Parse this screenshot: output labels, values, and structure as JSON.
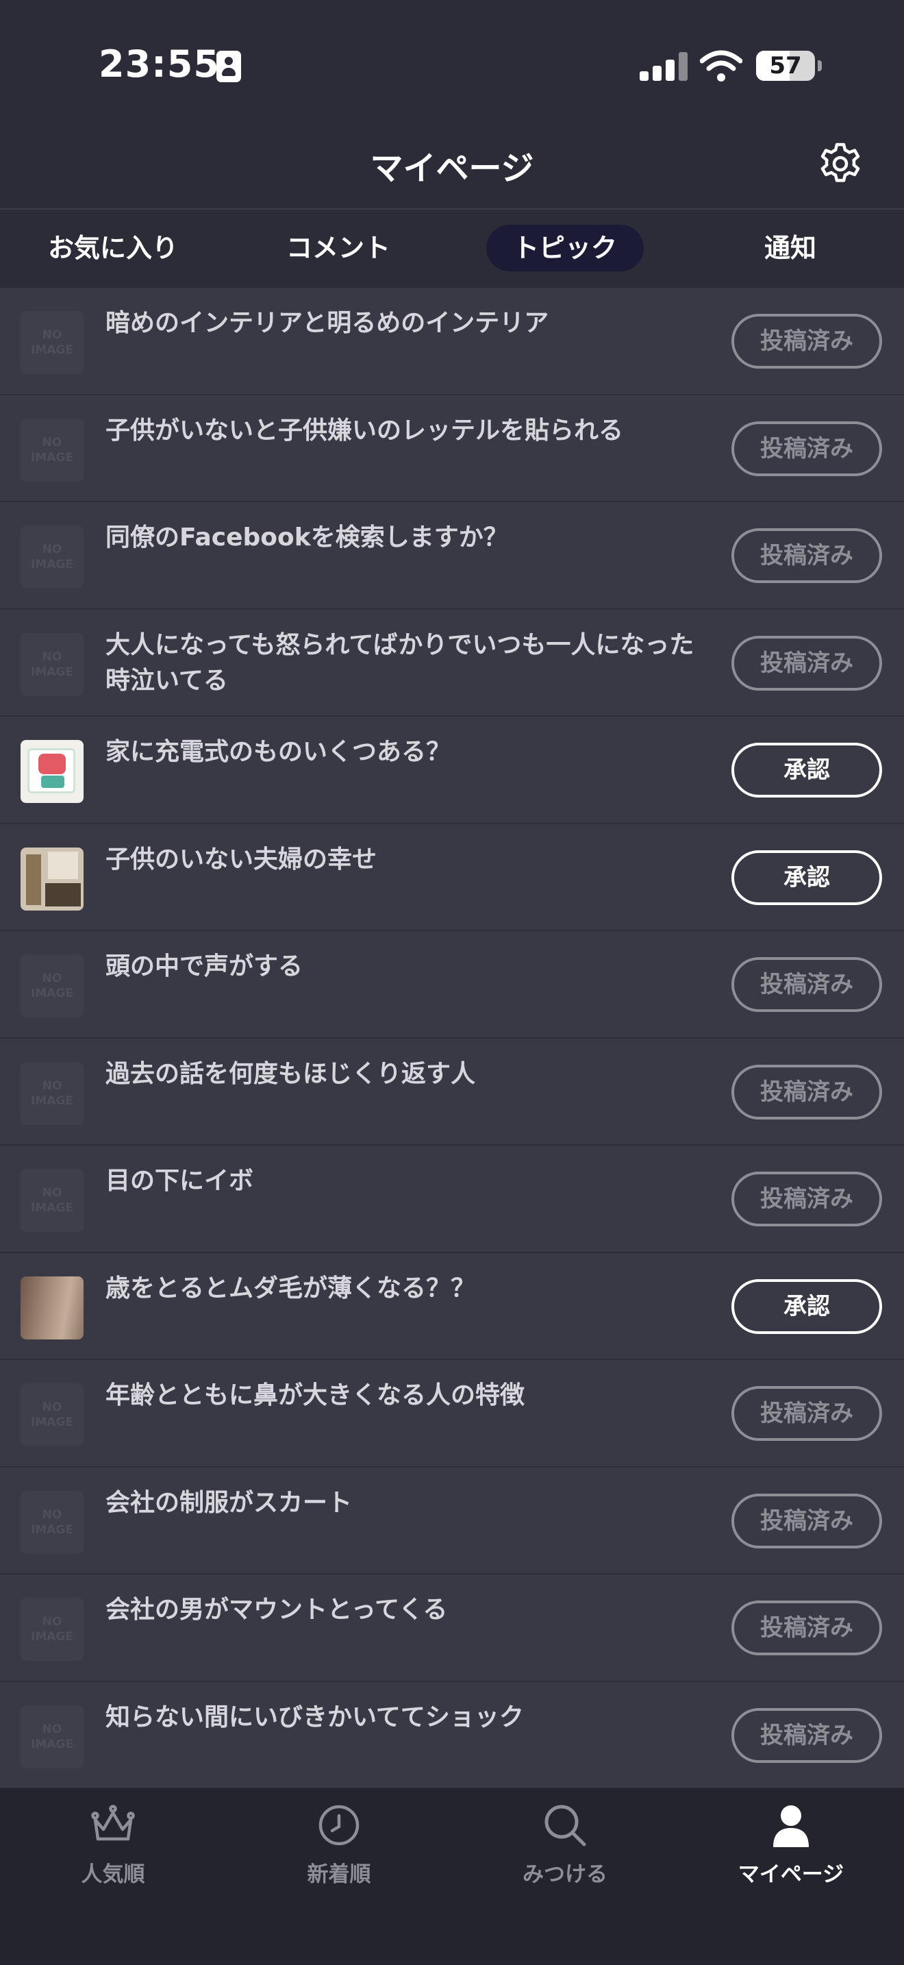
{
  "status_bar": {
    "time": "23:55",
    "battery": "57",
    "battery_level": 0.57
  },
  "header": {
    "title": "マイページ",
    "settings_icon": "gear-icon"
  },
  "tabs": [
    {
      "label": "お気に入り",
      "active": false
    },
    {
      "label": "コメント",
      "active": false
    },
    {
      "label": "トピック",
      "active": true
    },
    {
      "label": "通知",
      "active": false
    }
  ],
  "topics": [
    {
      "title": "暗めのインテリアと明るめのインテリア",
      "status": "投稿済み",
      "thumb": "noimage"
    },
    {
      "title": "子供がいないと子供嫌いのレッテルを貼られる",
      "status": "投稿済み",
      "thumb": "noimage"
    },
    {
      "title": "同僚のFacebookを検索しますか？",
      "status": "投稿済み",
      "thumb": "noimage"
    },
    {
      "title": "大人になっても怒られてばかりでいつも一人になった時泣いてる",
      "status": "投稿済み",
      "thumb": "noimage"
    },
    {
      "title": "家に充電式のものいくつある？",
      "status": "承認",
      "thumb": "book"
    },
    {
      "title": "子供のいない夫婦の幸せ",
      "status": "承認",
      "thumb": "room"
    },
    {
      "title": "頭の中で声がする",
      "status": "投稿済み",
      "thumb": "noimage"
    },
    {
      "title": "過去の話を何度もほじくり返す人",
      "status": "投稿済み",
      "thumb": "noimage"
    },
    {
      "title": "目の下にイボ",
      "status": "投稿済み",
      "thumb": "noimage"
    },
    {
      "title": "歳をとるとムダ毛が薄くなる？？",
      "status": "承認",
      "thumb": "skin"
    },
    {
      "title": "年齢とともに鼻が大きくなる人の特徴",
      "status": "投稿済み",
      "thumb": "noimage"
    },
    {
      "title": "会社の制服がスカート",
      "status": "投稿済み",
      "thumb": "noimage"
    },
    {
      "title": "会社の男がマウントとってくる",
      "status": "投稿済み",
      "thumb": "noimage"
    },
    {
      "title": "知らない間にいびきかいててショック",
      "status": "投稿済み",
      "thumb": "noimage"
    }
  ],
  "placeholder_thumb": {
    "line1": "NO",
    "line2": "IMAGE"
  },
  "bottom_nav": [
    {
      "label": "人気順",
      "icon": "crown-icon",
      "active": false
    },
    {
      "label": "新着順",
      "icon": "clock-icon",
      "active": false
    },
    {
      "label": "みつける",
      "icon": "search-icon",
      "active": false
    },
    {
      "label": "マイページ",
      "icon": "person-icon",
      "active": true
    }
  ],
  "colors": {
    "background": "#2c2c38",
    "row": "#393945",
    "nav": "#24242e",
    "active_tab": "#1b1b36",
    "muted": "#8e8e96"
  }
}
